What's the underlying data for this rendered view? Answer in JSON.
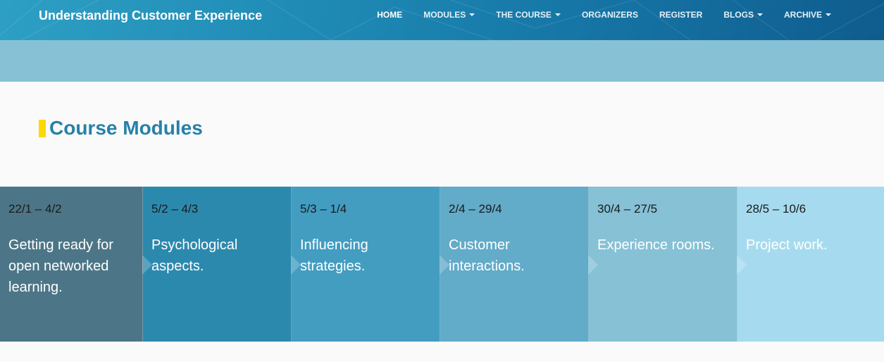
{
  "header": {
    "brand": "Understanding Customer Experience",
    "nav": [
      {
        "label": "HOME",
        "dropdown": false,
        "active": true
      },
      {
        "label": "MODULES",
        "dropdown": true,
        "active": false
      },
      {
        "label": "THE COURSE",
        "dropdown": true,
        "active": false
      },
      {
        "label": "ORGANIZERS",
        "dropdown": false,
        "active": false
      },
      {
        "label": "REGISTER",
        "dropdown": false,
        "active": false
      },
      {
        "label": "BLOGS",
        "dropdown": true,
        "active": false
      },
      {
        "label": "ARCHIVE",
        "dropdown": true,
        "active": false
      }
    ]
  },
  "section": {
    "title": "Course Modules",
    "marker_color": "#ffd700",
    "title_color": "#2681a8"
  },
  "modules": [
    {
      "dates": "22/1 – 4/2",
      "title": "Getting ready for open networked learning.",
      "color": "#4c7687"
    },
    {
      "dates": "5/2 – 4/3",
      "title": "Psychological aspects.",
      "color": "#2c89ae"
    },
    {
      "dates": "5/3 – 1/4",
      "title": "Influencing strategies.",
      "color": "#429dc1"
    },
    {
      "dates": "2/4 – 29/4",
      "title": "Customer interactions.",
      "color": "#62abc9"
    },
    {
      "dates": "30/4 – 27/5",
      "title": "Experience rooms.",
      "color": "#86c1d6"
    },
    {
      "dates": "28/5 – 10/6",
      "title": "Project work.",
      "color": "#a6dbef"
    }
  ],
  "colors": {
    "navbar": "#1f8bb5",
    "hero_band": "#86c1d6",
    "page_background": "#fafafa"
  }
}
